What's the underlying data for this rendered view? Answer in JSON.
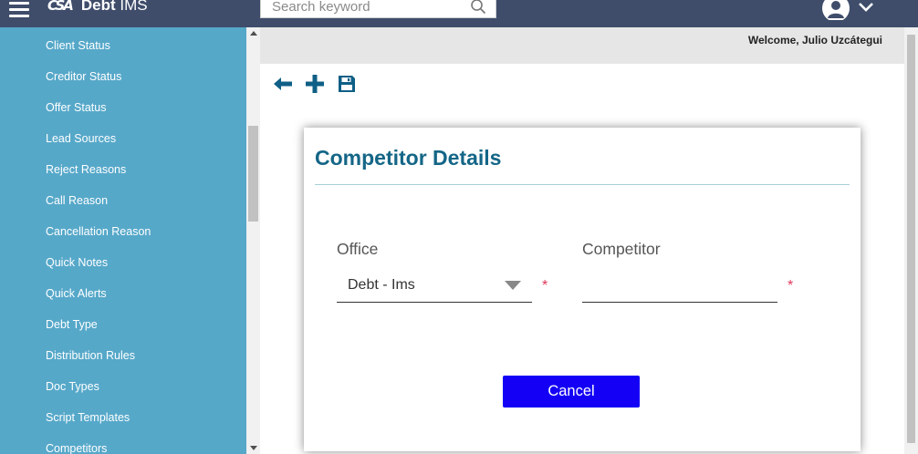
{
  "header": {
    "logo_mark": "CSA",
    "app_name_bold": "Debt",
    "app_name_rest": " IMS",
    "search_placeholder": "Search keyword"
  },
  "sidebar": {
    "items": [
      {
        "label": "Client Status"
      },
      {
        "label": "Creditor Status"
      },
      {
        "label": "Offer Status"
      },
      {
        "label": "Lead Sources"
      },
      {
        "label": "Reject Reasons"
      },
      {
        "label": "Call Reason"
      },
      {
        "label": "Cancellation Reason"
      },
      {
        "label": "Quick Notes"
      },
      {
        "label": "Quick Alerts"
      },
      {
        "label": "Debt Type"
      },
      {
        "label": "Distribution Rules"
      },
      {
        "label": "Doc Types"
      },
      {
        "label": "Script Templates"
      },
      {
        "label": "Competitors"
      }
    ]
  },
  "welcome": {
    "text": "Welcome, Julio Uzcátegui"
  },
  "toolbar": {
    "icons": [
      "arrow-left-icon",
      "plus-icon",
      "floppy-disk-icon"
    ]
  },
  "form": {
    "title": "Competitor Details",
    "office_label": "Office",
    "office_value": "Debt - Ims",
    "competitor_label": "Competitor",
    "competitor_value": "",
    "required_mark": "*",
    "cancel_label": "Cancel"
  },
  "colors": {
    "topbar": "#3f4d6b",
    "sidebar": "#56a8c9",
    "title": "#146687",
    "cancel_button": "#1300f5",
    "required": "#e0365a",
    "icon_accent": "#0f5f86"
  }
}
